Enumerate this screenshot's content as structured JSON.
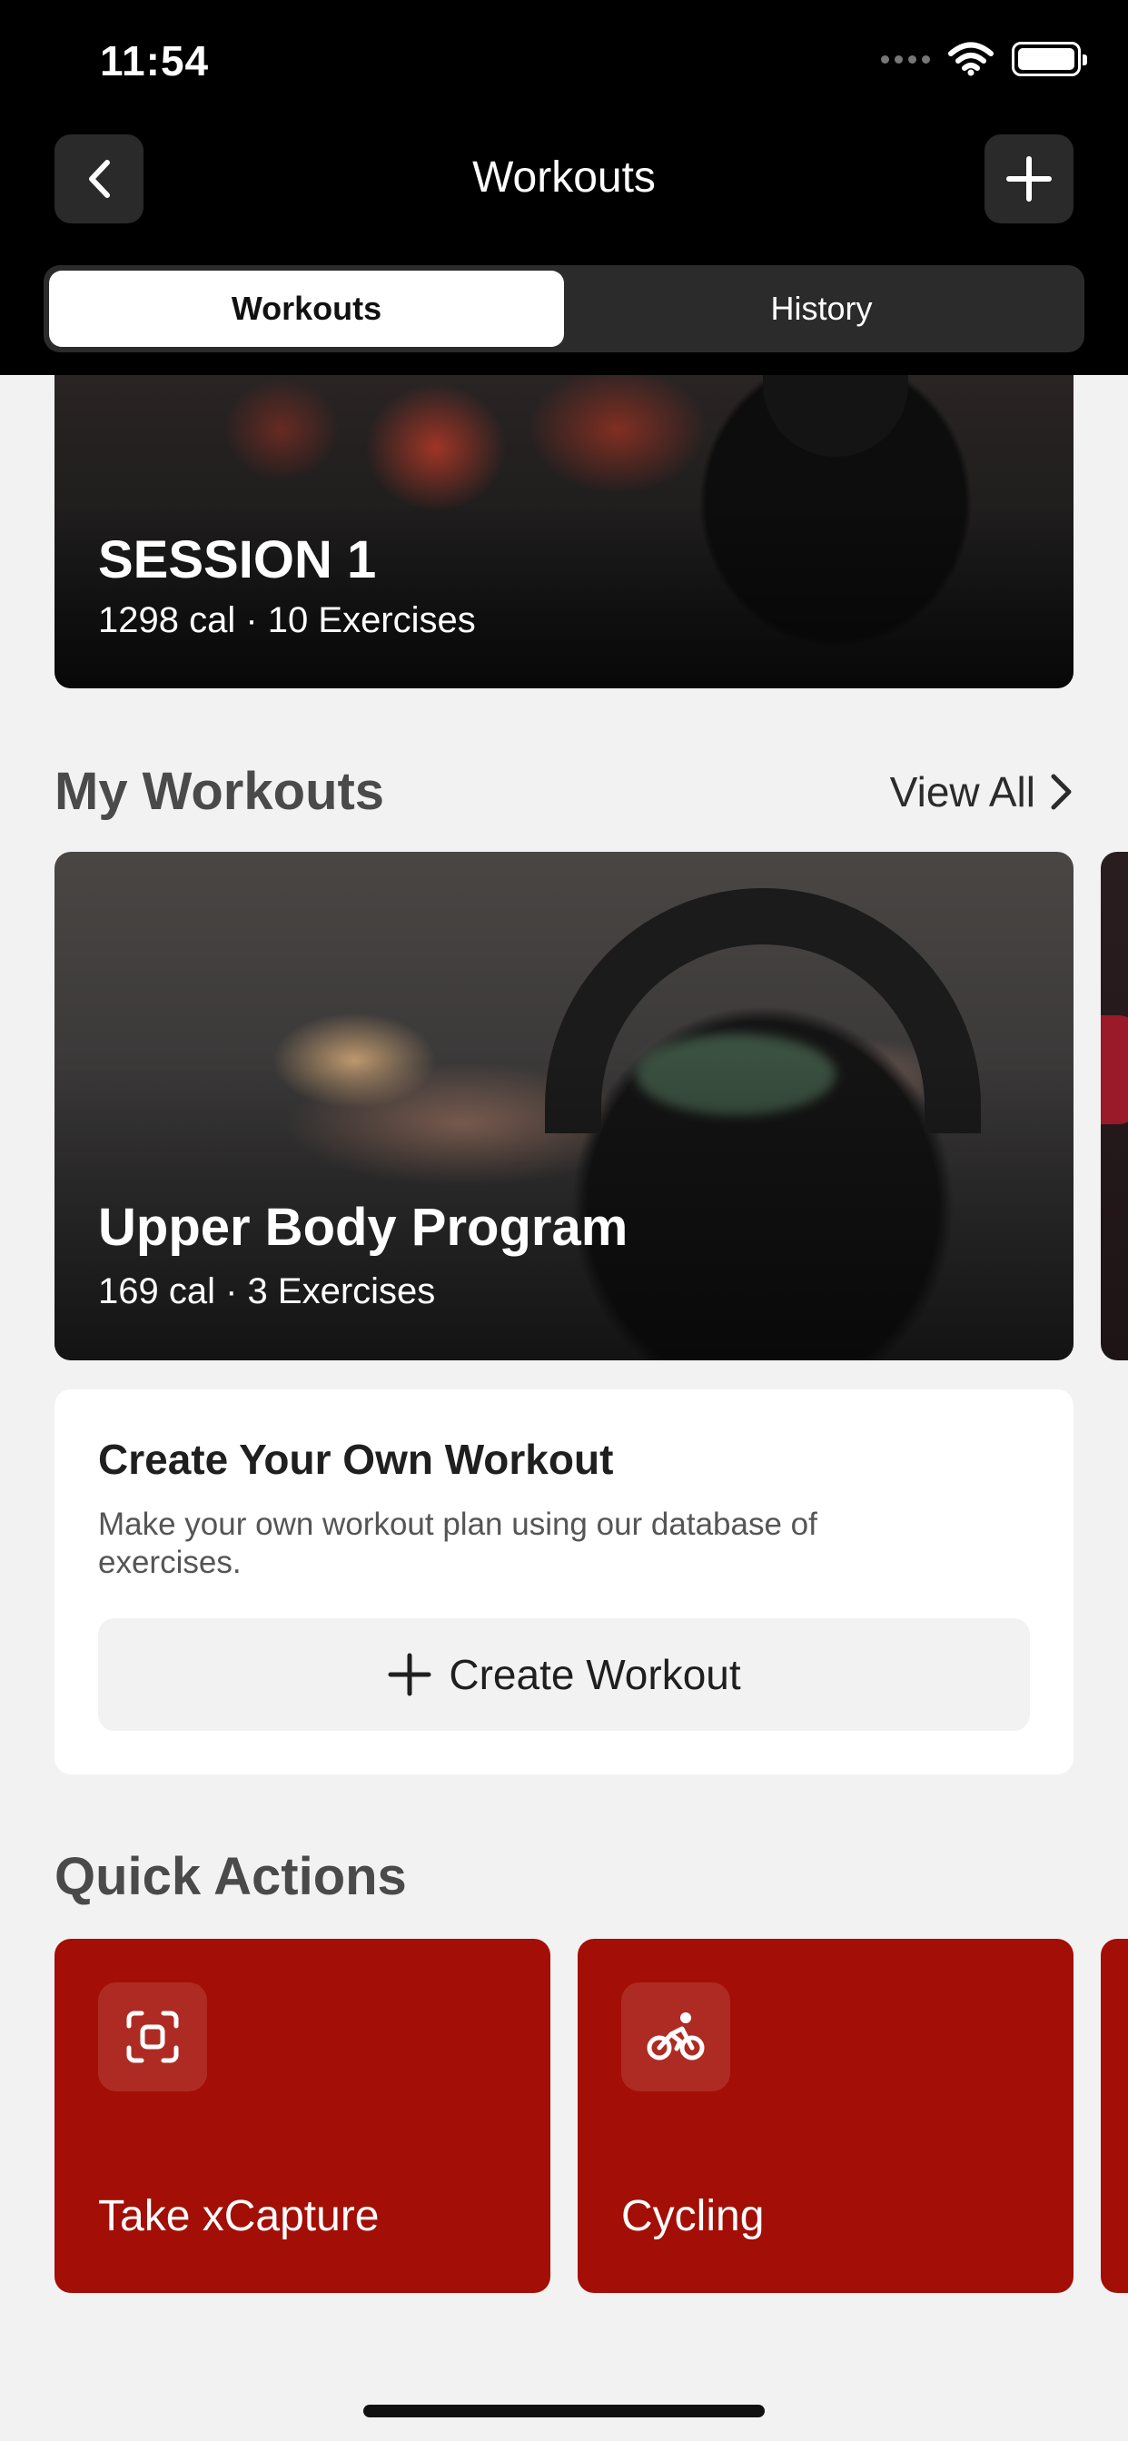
{
  "status_bar": {
    "time": "11:54"
  },
  "nav": {
    "title": "Workouts"
  },
  "tabs": [
    {
      "label": "Workouts",
      "active": true
    },
    {
      "label": "History",
      "active": false
    }
  ],
  "featured": {
    "title": "SESSION 1",
    "subtitle": "1298 cal · 10 Exercises"
  },
  "my_workouts": {
    "heading": "My Workouts",
    "view_all": "View All",
    "items": [
      {
        "title": "Upper Body Program",
        "subtitle": "169 cal · 3 Exercises"
      }
    ]
  },
  "create": {
    "title": "Create Your Own Workout",
    "description": "Make your own workout plan using our database of exercises.",
    "button_label": "Create Workout"
  },
  "quick_actions": {
    "heading": "Quick Actions",
    "items": [
      {
        "label": "Take xCapture",
        "icon": "scan-icon"
      },
      {
        "label": "Cycling",
        "icon": "cycling-icon"
      }
    ]
  },
  "colors": {
    "accent": "#a30e06",
    "header_bg": "#000000",
    "page_bg": "#f2f2f3"
  }
}
